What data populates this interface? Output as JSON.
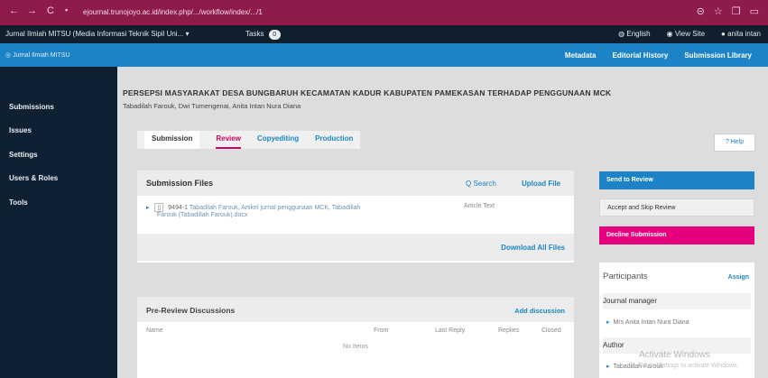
{
  "browser": {
    "back": "←",
    "forward": "→",
    "reload": "C",
    "url": "ejournal.trunojoyo.ac.id/index.php/.../workflow/index/.../1",
    "icons": [
      "⊝",
      "☆",
      "❐",
      "▭"
    ]
  },
  "topbar": {
    "journal": "Jurnal Ilmiah MITSU (Media Informasi Teknik Sipil Uni...",
    "journal_caret": "▾",
    "tasks_label": "Tasks",
    "tasks_count": "0",
    "language": "English",
    "view_site": "View Site",
    "user": "anita intan"
  },
  "sidebar": {
    "brand": "Jurnal Ilmiah MITSU",
    "items": [
      {
        "label": "Submissions"
      },
      {
        "label": "Issues"
      },
      {
        "label": "Settings"
      },
      {
        "label": "Users & Roles"
      },
      {
        "label": "Tools"
      }
    ]
  },
  "header": {
    "links": [
      "Metadata",
      "Editorial History",
      "Submission Library"
    ]
  },
  "submission": {
    "title": "PERSEPSI MASYARAKAT DESA BUNGBARUH KECAMATAN KADUR KABUPATEN PAMEKASAN TERHADAP PENGGUNAAN MCK",
    "authors": "Tabadilah Farouk, Dwi Tumengenai, Anita Intan Nura Diana"
  },
  "tabs": [
    {
      "label": "Submission",
      "state": "active"
    },
    {
      "label": "Review",
      "state": "selected"
    },
    {
      "label": "Copyediting",
      "state": "normal"
    },
    {
      "label": "Production",
      "state": "normal"
    }
  ],
  "help": "? Help",
  "files": {
    "heading": "Submission Files",
    "search": "Q Search",
    "upload": "Upload File",
    "rows": [
      {
        "id": "9494-1",
        "name": "Tabadilah Farouk, Artikel jurnal penggunaan MCK, Tabadillah",
        "line2": "Farouk (Tabadillah Farouk).docx",
        "type": "Article Text"
      }
    ],
    "download_all": "Download All Files"
  },
  "discussions": {
    "heading": "Pre-Review Discussions",
    "add": "Add discussion",
    "columns": [
      "Name",
      "From",
      "Last Reply",
      "Replies",
      "Closed"
    ],
    "empty": "No Items"
  },
  "actions": {
    "send_review": "Send to Review",
    "accept_skip": "Accept and Skip Review",
    "decline": "Decline Submission"
  },
  "participants": {
    "heading": "Participants",
    "assign": "Assign",
    "groups": [
      {
        "role": "Journal manager",
        "members": [
          "Mrs Anita Intan Nura Diana"
        ]
      },
      {
        "role": "Author",
        "members": [
          "Tabadillah Farouk"
        ]
      }
    ]
  },
  "watermark": {
    "line1": "Activate Windows",
    "line2": "Go to Settings to activate Windows."
  }
}
